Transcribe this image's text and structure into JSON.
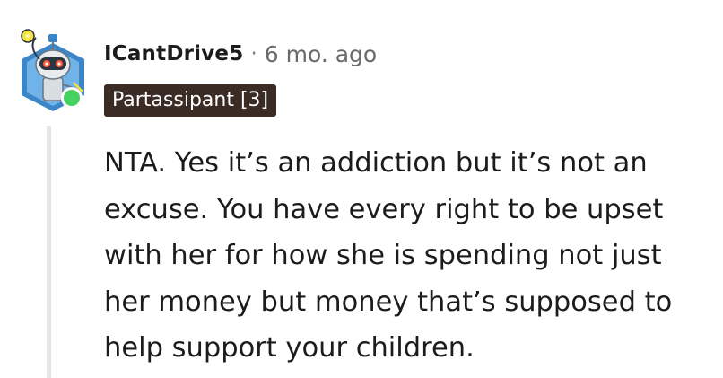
{
  "comment": {
    "author": "ICantDrive5",
    "separator": "·",
    "timestamp": "6 mo. ago",
    "flair": "Partassipant [3]",
    "avatar_icon": "snoo-robot-avatar-icon",
    "online_status_color": "#46d160",
    "body_lines": [
      "NTA. Yes it’s an addiction but it’s not an",
      "excuse. You have every right to be upset",
      "with her for how she is spending not just",
      "her money but money that’s supposed to",
      "help support your children."
    ]
  },
  "colors": {
    "flair_background": "#3a2b25",
    "flair_text": "#ffffff",
    "thread_line": "#e5e5e5",
    "text": "#1c1c1c",
    "muted_text": "#6a6a6a"
  }
}
